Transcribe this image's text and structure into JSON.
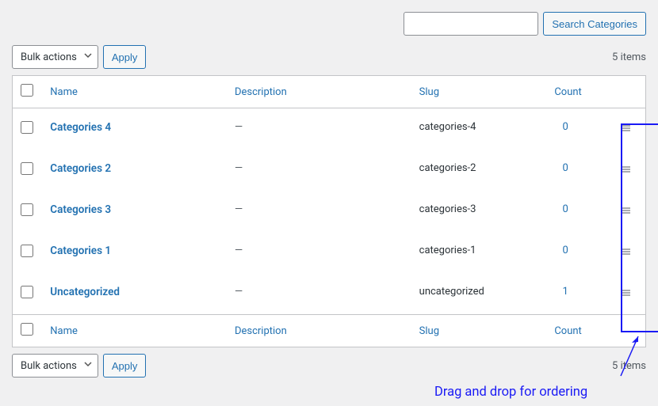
{
  "search": {
    "value": "",
    "button_label": "Search Categories"
  },
  "bulk": {
    "select_label": "Bulk actions",
    "apply_label": "Apply"
  },
  "items_count": "5 items",
  "columns": {
    "name": "Name",
    "description": "Description",
    "slug": "Slug",
    "count": "Count"
  },
  "rows": [
    {
      "name": "Categories 4",
      "description": "—",
      "slug": "categories-4",
      "count": "0"
    },
    {
      "name": "Categories 2",
      "description": "—",
      "slug": "categories-2",
      "count": "0"
    },
    {
      "name": "Categories 3",
      "description": "—",
      "slug": "categories-3",
      "count": "0"
    },
    {
      "name": "Categories 1",
      "description": "—",
      "slug": "categories-1",
      "count": "0"
    },
    {
      "name": "Uncategorized",
      "description": "—",
      "slug": "uncategorized",
      "count": "1"
    }
  ],
  "annotation": {
    "text": "Drag and drop for ordering"
  }
}
